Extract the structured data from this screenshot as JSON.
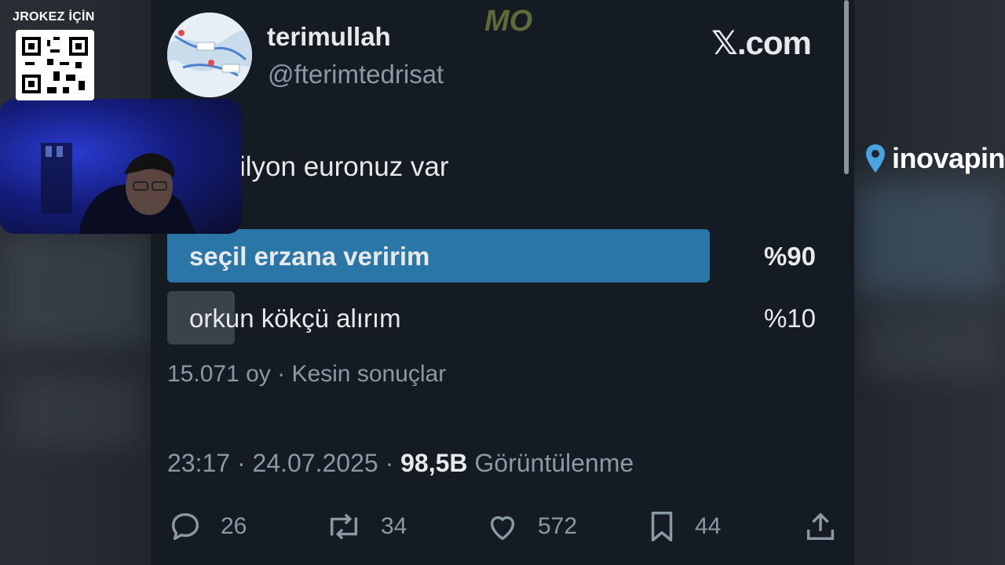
{
  "overlay": {
    "qr_label": "JROKEZ İÇİN",
    "watermark": "MO",
    "sponsor": "inovapin"
  },
  "tweet": {
    "author_name": "terimullah",
    "author_handle": "@fterimtedrisat",
    "source_logo": "𝕏.com",
    "text": "ilyon euronuz var",
    "poll": {
      "options": [
        {
          "label": "seçil erzana veririm",
          "percent_label": "%90",
          "share": 0.9,
          "winner": true
        },
        {
          "label": "orkun kökçü alırım",
          "percent_label": "%10",
          "share": 0.1,
          "winner": false
        }
      ],
      "meta": "15.071 oy · Kesin sonuçlar"
    },
    "time": "23:17",
    "date": "24.07.2025",
    "views_count": "98,5B",
    "views_label": "Görüntülenme",
    "actions": {
      "reply_icon": "reply-icon",
      "reply_count": "26",
      "retweet_icon": "retweet-icon",
      "retweet_count": "34",
      "like_icon": "heart-icon",
      "like_count": "572",
      "bookmark_icon": "bookmark-icon",
      "bookmark_count": "44",
      "share_icon": "share-icon"
    }
  },
  "colors": {
    "poll_winner": "#2a76a7",
    "poll_other": "#3a434c",
    "background": "#151b22"
  }
}
